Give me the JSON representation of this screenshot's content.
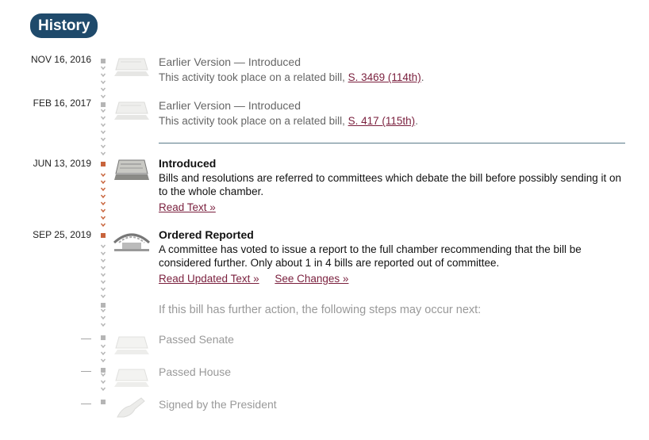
{
  "section": {
    "title": "History"
  },
  "events": [
    {
      "date": "NOV 16, 2016",
      "title": "Earlier Version — Introduced",
      "desc_prefix": "This activity took place on a related bill, ",
      "link": "S. 3469 (114th)",
      "desc_suffix": "."
    },
    {
      "date": "FEB 16, 2017",
      "title": "Earlier Version — Introduced",
      "desc_prefix": "This activity took place on a related bill, ",
      "link": "S. 417 (115th)",
      "desc_suffix": "."
    },
    {
      "date": "JUN 13, 2019",
      "title": "Introduced",
      "desc": "Bills and resolutions are referred to committees which debate the bill before possibly sending it on to the whole chamber.",
      "links": [
        "Read Text »"
      ]
    },
    {
      "date": "SEP 25, 2019",
      "title": "Ordered Reported",
      "desc": "A committee has voted to issue a report to the full chamber recommending that the bill be considered further. Only about 1 in 4 bills are reported out of committee.",
      "links": [
        "Read Updated Text »",
        "See Changes »"
      ]
    }
  ],
  "future": {
    "note": "If this bill has further action, the following steps may occur next:",
    "steps": [
      {
        "dash": "—",
        "title": "Passed Senate"
      },
      {
        "dash": "—",
        "title": "Passed House"
      },
      {
        "dash": "—",
        "title": "Signed by the President"
      }
    ]
  },
  "colors": {
    "badge": "#1f4a6b",
    "link": "#7a1f3d",
    "track_active": "#c8643c",
    "track_inactive": "#b5b5b5"
  },
  "icons": {
    "bill": "document-stack-icon",
    "committee": "committee-chamber-icon",
    "sign": "signing-hand-icon"
  }
}
